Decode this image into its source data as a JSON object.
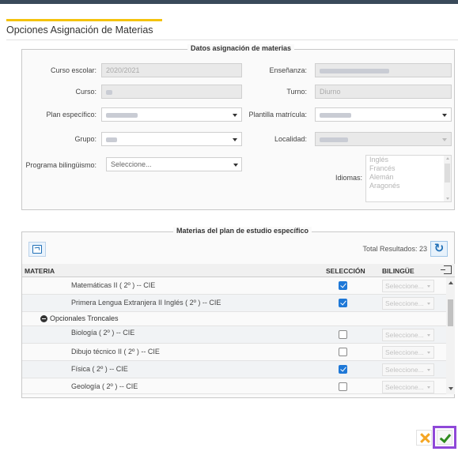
{
  "dialog": {
    "title": "Opciones Asignación de Materias"
  },
  "datos": {
    "legend": "Datos asignación de materias",
    "curso_escolar": {
      "label": "Curso escolar:",
      "value": "2020/2021"
    },
    "ensenanza": {
      "label": "Enseñanza:"
    },
    "curso": {
      "label": "Curso:"
    },
    "turno": {
      "label": "Turno:",
      "value": "Diurno"
    },
    "plan_especifico": {
      "label": "Plan específico:"
    },
    "plantilla_matricula": {
      "label": "Plantilla matrícula:"
    },
    "grupo": {
      "label": "Grupo:"
    },
    "localidad": {
      "label": "Localidad:"
    },
    "programa_bilinguismo": {
      "label": "Programa bilingüismo:",
      "placeholder": "Seleccione..."
    },
    "idiomas": {
      "label": "Idiomas:",
      "options": [
        "Inglés",
        "Francés",
        "Alemán",
        "Aragonés"
      ]
    }
  },
  "materias": {
    "legend": "Materias del plan de estudio específico",
    "total_resultados": "Total Resultados: 23",
    "columns": {
      "materia": "MATERIA",
      "seleccion": "SELECCIÓN",
      "bilingue": "BILINGÜE"
    },
    "rows": [
      {
        "type": "item",
        "name": "Matemáticas II ( 2º ) -- CIE",
        "selected": true,
        "bilingue": "Seleccione..."
      },
      {
        "type": "item",
        "name": "Primera Lengua Extranjera II Inglés ( 2º ) -- CIE",
        "selected": true,
        "bilingue": "Seleccione..."
      },
      {
        "type": "group",
        "name": "Opcionales Troncales"
      },
      {
        "type": "item",
        "name": "Biología ( 2º ) -- CIE",
        "selected": false,
        "bilingue": "Seleccione..."
      },
      {
        "type": "item",
        "name": "Dibujo técnico II ( 2º ) -- CIE",
        "selected": false,
        "bilingue": "Seleccione..."
      },
      {
        "type": "item",
        "name": "Física ( 2º ) -- CIE",
        "selected": true,
        "bilingue": "Seleccione..."
      },
      {
        "type": "item",
        "name": "Geología ( 2º ) -- CIE",
        "selected": false,
        "bilingue": "Seleccione..."
      }
    ]
  },
  "colors": {
    "accent": "#f4c20d",
    "checkbox_on": "#1e78d7",
    "ok_highlight": "#8f48d8",
    "cancel": "#f5a623",
    "ok": "#2e8b1e"
  }
}
